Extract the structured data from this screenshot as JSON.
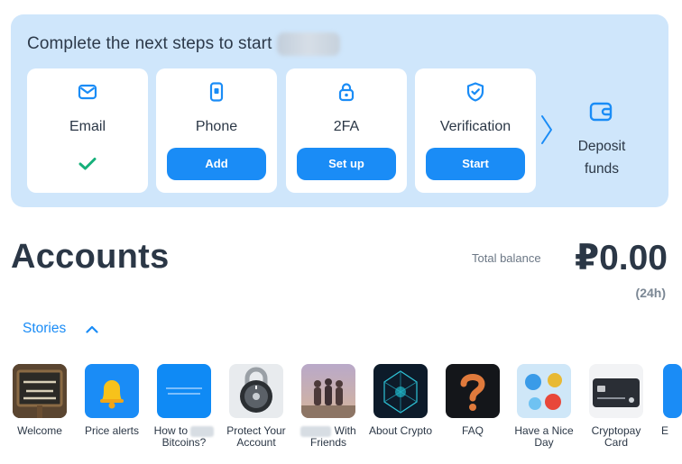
{
  "onboarding": {
    "title": "Complete the next steps to start",
    "steps": [
      {
        "label": "Email",
        "icon": "envelope-icon",
        "status": "done"
      },
      {
        "label": "Phone",
        "icon": "phone-icon",
        "button": "Add"
      },
      {
        "label": "2FA",
        "icon": "lock-icon",
        "button": "Set up"
      },
      {
        "label": "Verification",
        "icon": "shield-check-icon",
        "button": "Start"
      }
    ],
    "deposit": {
      "label": "Deposit funds",
      "icon": "wallet-icon"
    }
  },
  "accounts": {
    "title": "Accounts",
    "total_label": "Total balance",
    "balance": "₽0.00",
    "period": "(24h)"
  },
  "stories": {
    "toggle_label": "Stories",
    "items": [
      {
        "label": "Welcome"
      },
      {
        "label": "Price alerts"
      },
      {
        "label": "How to",
        "label2": "Bitcoins?"
      },
      {
        "label": "Protect Your",
        "label2": "Account"
      },
      {
        "label": "With",
        "label2": "Friends"
      },
      {
        "label": "About Crypto"
      },
      {
        "label": "FAQ"
      },
      {
        "label": "Have a Nice",
        "label2": "Day"
      },
      {
        "label": "Cryptopay",
        "label2": "Card"
      },
      {
        "label": "E"
      }
    ]
  },
  "colors": {
    "accent": "#1a8cf6",
    "panel": "#cfe6fb",
    "success": "#16b07a"
  }
}
